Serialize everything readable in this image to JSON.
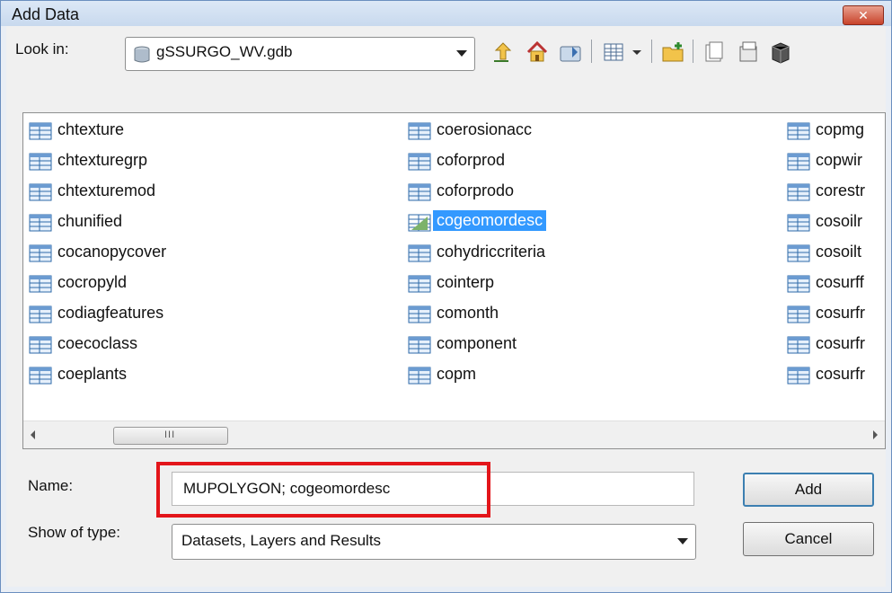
{
  "window": {
    "title": "Add Data",
    "close_glyph": "✕"
  },
  "lookin": {
    "label": "Look in:",
    "value": "gSSURGO_WV.gdb"
  },
  "toolbar": {
    "icons": [
      "up-one-level-icon",
      "home-icon",
      "connect-folder-icon",
      "view-menu-icon",
      "new-item-icon",
      "catalog-icon",
      "database-icon",
      "toolbox-icon"
    ]
  },
  "files": {
    "col1": [
      "chtexture",
      "chtexturegrp",
      "chtexturemod",
      "chunified",
      "cocanopycover",
      "cocropyld",
      "codiagfeatures",
      "coecoclass",
      "coeplants"
    ],
    "col2": [
      "coerosionacc",
      "coforprod",
      "coforprodo",
      "cogeomordesc",
      "cohydriccriteria",
      "cointerp",
      "comonth",
      "component",
      "copm"
    ],
    "col3": [
      "copmg",
      "copwir",
      "corestr",
      "cosoilr",
      "cosoilt",
      "cosurff",
      "cosurfr",
      "cosurfr",
      "cosurfr"
    ],
    "selected": "cogeomordesc",
    "scroll_grip": "III"
  },
  "name": {
    "label": "Name:",
    "value": "MUPOLYGON; cogeomordesc"
  },
  "type": {
    "label": "Show of type:",
    "value": "Datasets, Layers and Results"
  },
  "buttons": {
    "add": "Add",
    "cancel": "Cancel"
  },
  "colors": {
    "selection": "#3399ff",
    "highlight_box": "#e3151a"
  }
}
